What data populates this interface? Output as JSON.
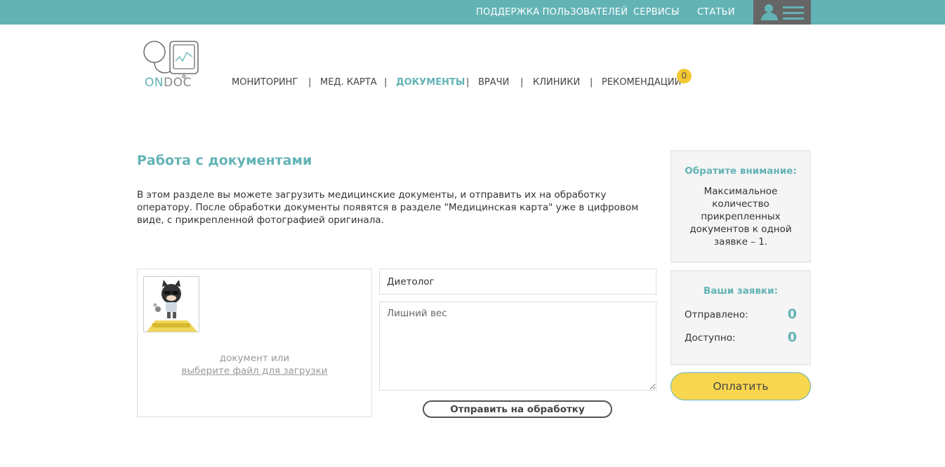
{
  "topbar": {
    "links": [
      {
        "label": "ПОДДЕРЖКА ПОЛЬЗОВАТЕЛЕЙ"
      },
      {
        "label": "СЕРВИСЫ"
      },
      {
        "label": "СТАТЬИ"
      }
    ],
    "background_color": "#63b3b5"
  },
  "logo": {
    "text_on": "ON",
    "text_doc": "DOC"
  },
  "nav": {
    "items": [
      {
        "label": "МОНИТОРИНГ"
      },
      {
        "label": "МЕД. КАРТА"
      },
      {
        "label": "ДОКУМЕНТЫ",
        "active": true
      },
      {
        "label": "ВРАЧИ"
      },
      {
        "label": "КЛИНИКИ"
      },
      {
        "label": "РЕКОМЕНДАЦИИ"
      }
    ],
    "separator": "|",
    "recommendations_badge": "0"
  },
  "main": {
    "title": "Работа с документами",
    "intro": "В этом разделе вы можете загрузить медицинские документы, и отправить их на обработку оператору. После обработки документы появятся в разделе \"Медицинская карта\" уже в цифровом виде, с прикрепленной фотографией оригинала."
  },
  "upload": {
    "hint": "документ или",
    "link": "выберите файл для загрузки"
  },
  "form": {
    "specialist_value": "Диетолог",
    "description_value": "Лишний вес",
    "submit_label": "Отправить на обработку"
  },
  "sidebar": {
    "notice_title": "Обратите внимание:",
    "notice_text": "Максимальное количество прикрепленных документов к одной заявке – 1.",
    "orders_title": "Ваши заявки:",
    "sent_label": "Отправлено:",
    "sent_value": "0",
    "available_label": "Доступно:",
    "available_value": "0",
    "pay_label": "Оплатить"
  },
  "colors": {
    "accent": "#63b3b5",
    "pay_button": "#f8d64e",
    "badge": "#f2c830"
  }
}
